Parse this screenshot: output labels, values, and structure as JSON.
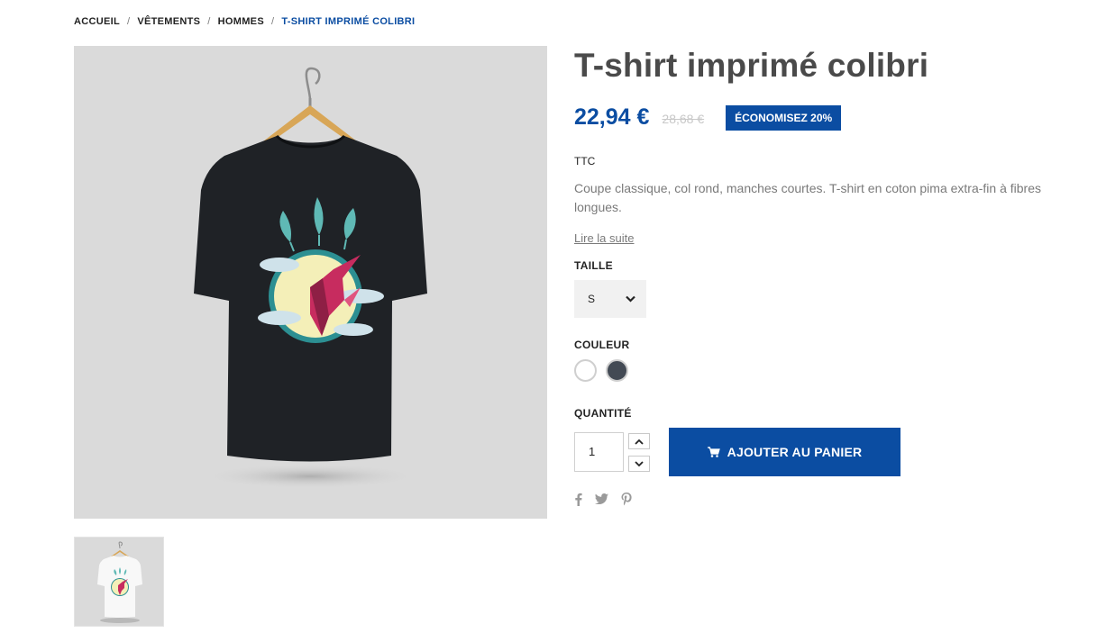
{
  "breadcrumb": {
    "items": [
      "ACCUEIL",
      "VÊTEMENTS",
      "HOMMES"
    ],
    "current": "T-SHIRT IMPRIMÉ COLIBRI",
    "separator": "/"
  },
  "product": {
    "title": "T-shirt imprimé colibri",
    "price": "22,94 €",
    "old_price": "28,68 €",
    "discount": "ÉCONOMISEZ 20%",
    "tax_label": "TTC",
    "description": "Coupe classique, col rond, manches courtes. T-shirt en coton pima extra-fin à fibres longues.",
    "read_more": "Lire la suite"
  },
  "options": {
    "size_label": "TAILLE",
    "size_value": "S",
    "color_label": "COULEUR",
    "colors": [
      "#ffffff",
      "#434a54"
    ]
  },
  "purchase": {
    "quantity_label": "QUANTITÉ",
    "quantity": "1",
    "add_to_cart": "AJOUTER AU PANIER"
  },
  "social": [
    "facebook-icon",
    "twitter-icon",
    "pinterest-icon"
  ],
  "theme": {
    "accent": "#0b4da2",
    "title_color": "#4a4a4a",
    "image_bg": "#dadada"
  }
}
